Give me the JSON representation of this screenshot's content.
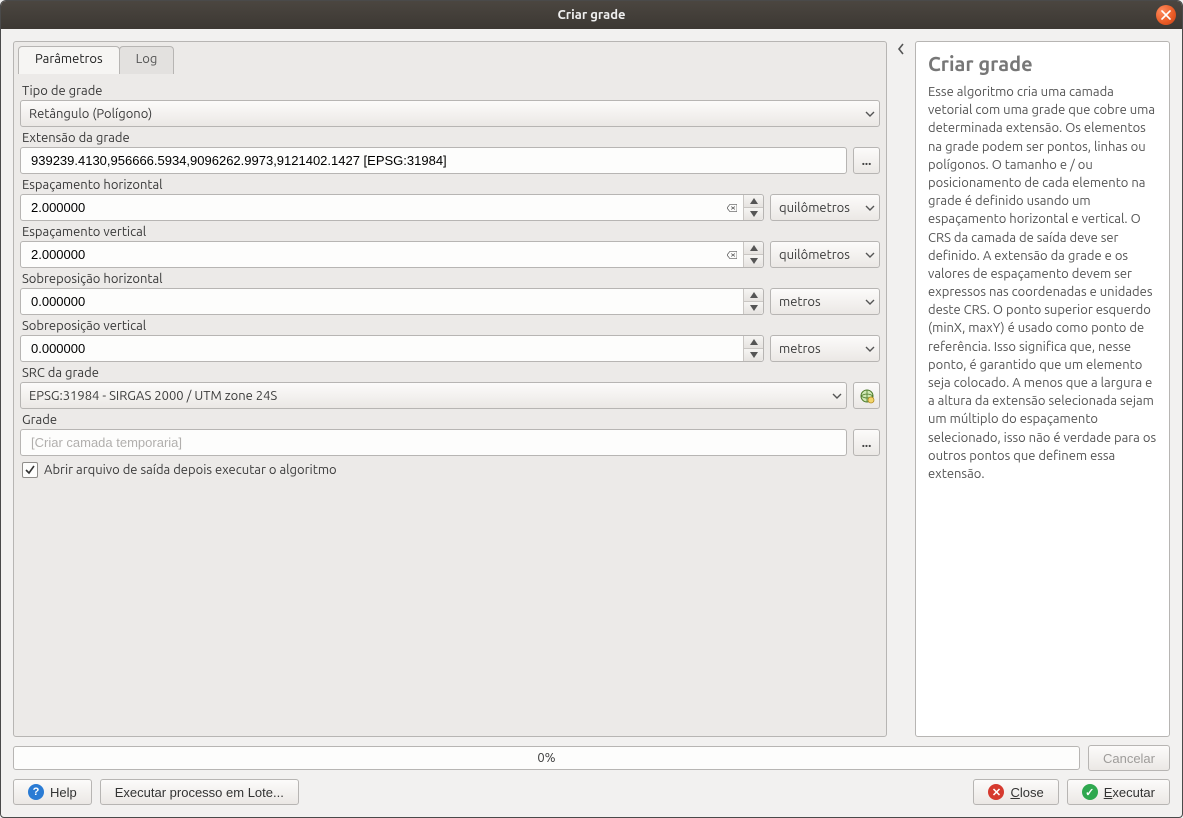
{
  "window": {
    "title": "Criar grade"
  },
  "tabs": {
    "parameters": "Parâmetros",
    "log": "Log"
  },
  "labels": {
    "grid_type": "Tipo de grade",
    "grid_extent": "Extensão da grade",
    "h_spacing": "Espaçamento horizontal",
    "v_spacing": "Espaçamento vertical",
    "h_overlay": "Sobreposição horizontal",
    "v_overlay": "Sobreposição vertical",
    "grid_crs": "SRC da grade",
    "grid": "Grade"
  },
  "values": {
    "grid_type": "Retângulo (Polígono)",
    "grid_extent": "939239.4130,956666.5934,9096262.9973,9121402.1427 [EPSG:31984]",
    "h_spacing": "2.000000",
    "v_spacing": "2.000000",
    "h_overlay": "0.000000",
    "v_overlay": "0.000000",
    "grid_crs": "EPSG:31984 - SIRGAS 2000 / UTM zone 24S",
    "output_placeholder": "[Criar camada temporaria]"
  },
  "units": {
    "km": "quilômetros",
    "m": "metros"
  },
  "checkbox": {
    "open_after": "Abrir arquivo de saída depois executar o algoritmo",
    "checked": true
  },
  "help_panel": {
    "title": "Criar grade",
    "body": "Esse algoritmo cria uma camada vetorial com uma grade que cobre uma determinada extensão. Os elementos na grade podem ser pontos, linhas ou polígonos. O tamanho e / ou posicionamento de cada elemento na grade é definido usando um espaçamento horizontal e vertical. O CRS da camada de saída deve ser definido. A extensão da grade e os valores de espaçamento devem ser expressos nas coordenadas e unidades deste CRS. O ponto superior esquerdo (minX, maxY) é usado como ponto de referência. Isso significa que, nesse ponto, é garantido que um elemento seja colocado. A menos que a largura e a altura da extensão selecionada sejam um múltiplo do espaçamento selecionado, isso não é verdade para os outros pontos que definem essa extensão."
  },
  "progress": {
    "text": "0%"
  },
  "buttons": {
    "cancel": "Cancelar",
    "help": "Help",
    "batch": "Executar processo em Lote...",
    "close_prefix": "C",
    "close_rest": "lose",
    "run_prefix": "E",
    "run_rest": "xecutar",
    "ellipsis": "..."
  }
}
